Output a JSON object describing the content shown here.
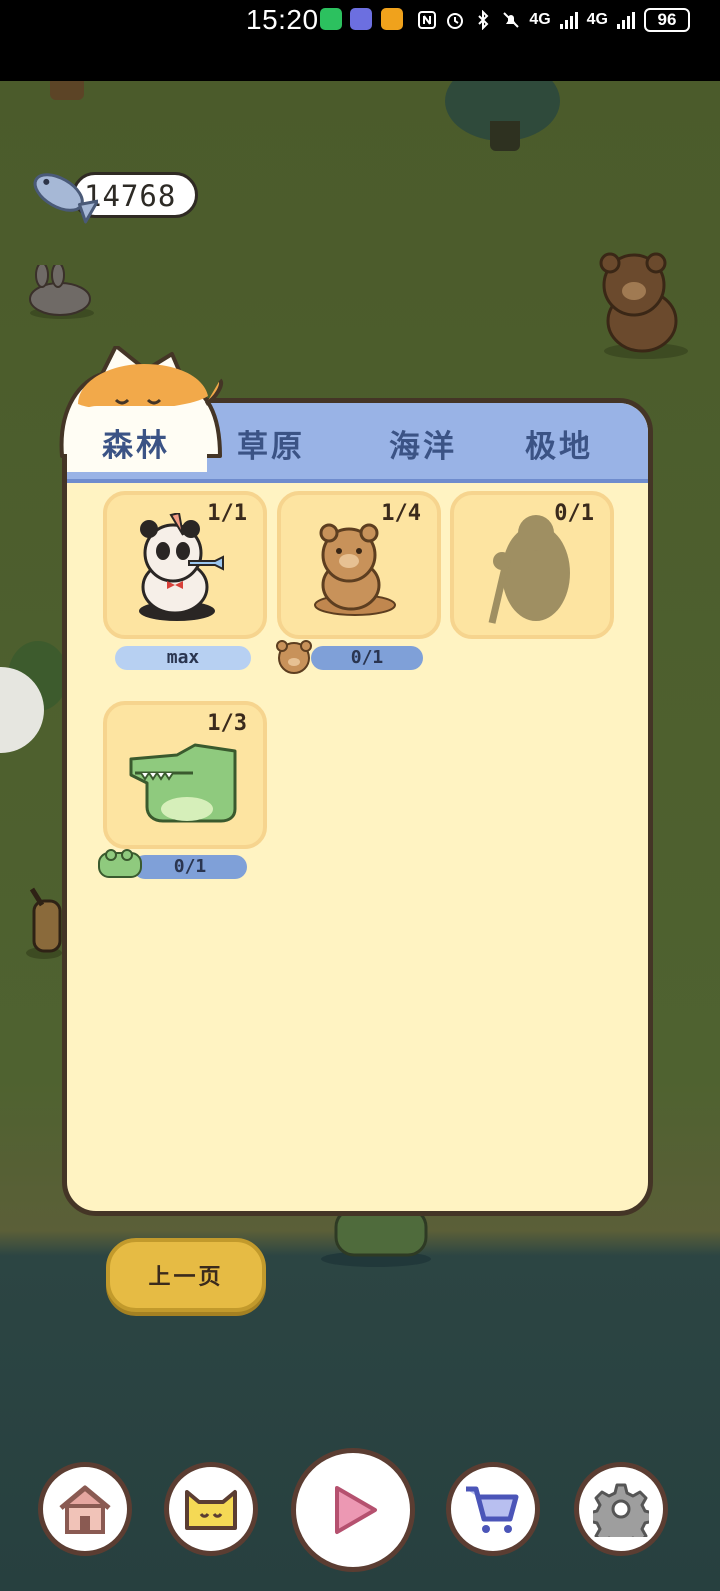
{
  "status_bar": {
    "time": "15:20",
    "network_1": "4G",
    "network_2": "4G",
    "battery": "96"
  },
  "hud": {
    "fish_count": "14768",
    "fish_icon": "fish-icon"
  },
  "collection": {
    "tabs": [
      {
        "label": "森林",
        "active": true
      },
      {
        "label": "草原",
        "active": false
      },
      {
        "label": "海洋",
        "active": false
      },
      {
        "label": "极地",
        "active": false
      }
    ],
    "cards": [
      {
        "name": "panda",
        "count": "1/1",
        "bar_label": "max",
        "unlocked": true
      },
      {
        "name": "bear",
        "count": "1/4",
        "bar_label": "0/1",
        "unlocked": true
      },
      {
        "name": "gorilla",
        "count": "0/1",
        "bar_label": "",
        "unlocked": false
      },
      {
        "name": "crocodile",
        "count": "1/3",
        "bar_label": "0/1",
        "unlocked": true
      }
    ]
  },
  "buttons": {
    "prev_page": "上一页"
  },
  "bottom_nav": [
    {
      "icon": "house-icon"
    },
    {
      "icon": "cat-face-icon"
    },
    {
      "icon": "play-icon"
    },
    {
      "icon": "cart-icon"
    },
    {
      "icon": "gear-icon"
    }
  ]
}
